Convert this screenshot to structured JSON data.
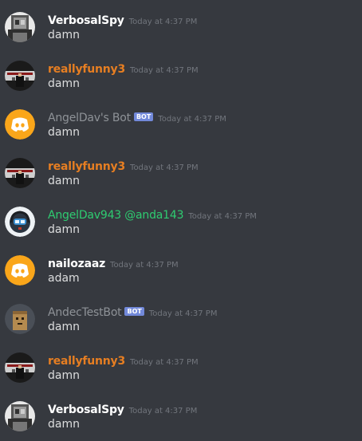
{
  "messages": [
    {
      "author": "VerbosalSpy",
      "author_color": "#ffffff",
      "timestamp": "Today at 4:37 PM",
      "content": "damn",
      "avatar": "pixel-portrait-avatar"
    },
    {
      "author": "reallyfunny3",
      "author_color": "#e67e22",
      "timestamp": "Today at 4:37 PM",
      "content": "damn",
      "avatar": "suited-figure-avatar"
    },
    {
      "author": "AngelDav's Bot",
      "author_color": "#8e9297",
      "bot_tag": "BOT",
      "timestamp": "Today at 4:37 PM",
      "content": "damn",
      "avatar": "discord-logo-avatar"
    },
    {
      "author": "reallyfunny3",
      "author_color": "#e67e22",
      "timestamp": "Today at 4:37 PM",
      "content": "damn",
      "avatar": "suited-figure-avatar"
    },
    {
      "author": "AngelDav943 @anda143",
      "author_color": "#2ecc71",
      "timestamp": "Today at 4:37 PM",
      "content": "damn",
      "avatar": "headset-character-avatar"
    },
    {
      "author": "nailozaaz",
      "author_color": "#ffffff",
      "timestamp": "Today at 4:37 PM",
      "content": "adam",
      "avatar": "discord-logo-avatar"
    },
    {
      "author": "AndecTestBot",
      "author_color": "#8e9297",
      "bot_tag": "BOT",
      "timestamp": "Today at 4:37 PM",
      "content": "damn",
      "avatar": "cardboard-box-avatar"
    },
    {
      "author": "reallyfunny3",
      "author_color": "#e67e22",
      "timestamp": "Today at 4:37 PM",
      "content": "damn",
      "avatar": "suited-figure-avatar"
    },
    {
      "author": "VerbosalSpy",
      "author_color": "#ffffff",
      "timestamp": "Today at 4:37 PM",
      "content": "damn",
      "avatar": "pixel-portrait-avatar"
    }
  ]
}
